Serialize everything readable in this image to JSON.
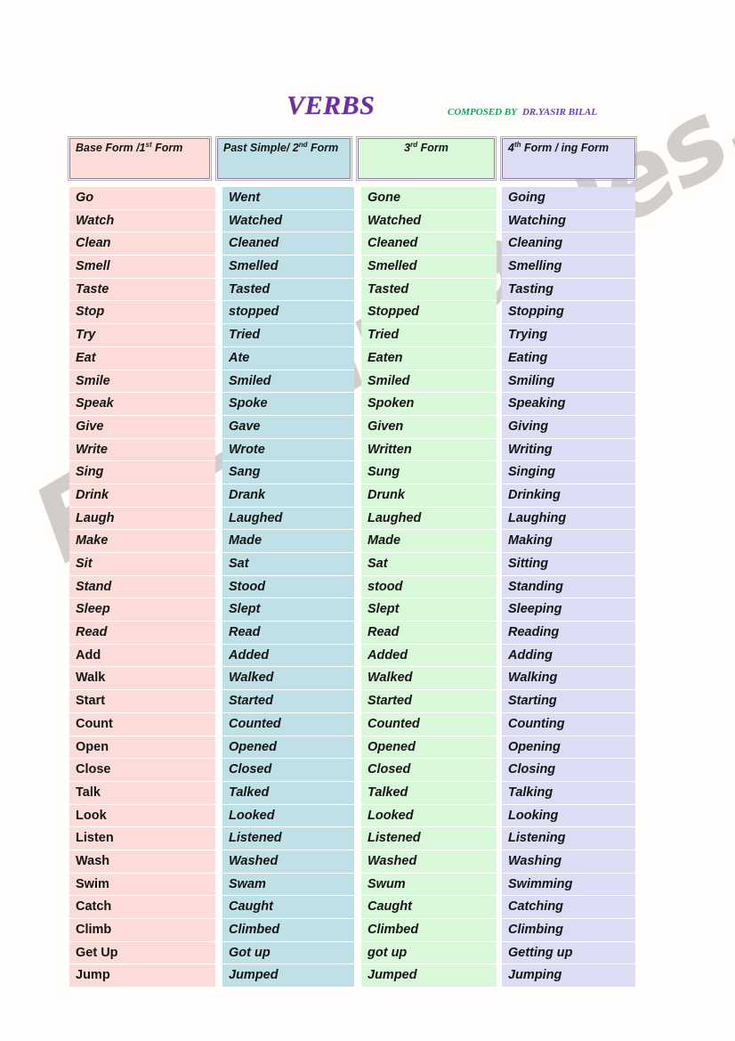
{
  "document": {
    "title": "VERBS",
    "credit_composed": "COMPOSED BY",
    "credit_author": "DR.YASIR BILAL",
    "watermark": "ESLprintables.com"
  },
  "colors": {
    "title": "#6b2f9e",
    "credit_composed": "#16a35a",
    "credit_author": "#6b3fa0",
    "col1_bg": "#fbdcd8",
    "col2_bg": "#bfe0e6",
    "col3_bg": "#d9f7d9",
    "col4_bg": "#dcdcf5",
    "header_border": "#8a7f92"
  },
  "table": {
    "headers": [
      {
        "main": "Base Form /1",
        "sup": "st",
        "tail": " Form",
        "align": "left"
      },
      {
        "main": "Past Simple/ 2",
        "sup": "nd",
        "tail": " Form",
        "align": "left"
      },
      {
        "main": "3",
        "sup": "rd",
        "tail": " Form",
        "align": "center"
      },
      {
        "main": "4",
        "sup": "th",
        "tail": " Form / ing Form",
        "align": "left"
      }
    ],
    "rows": [
      {
        "base": "Go",
        "past": "Went",
        "third": "Gone",
        "ing": "Going",
        "base_upright": false
      },
      {
        "base": "Watch",
        "past": "Watched",
        "third": "Watched",
        "ing": "Watching",
        "base_upright": false
      },
      {
        "base": "Clean",
        "past": "Cleaned",
        "third": "Cleaned",
        "ing": "Cleaning",
        "base_upright": false
      },
      {
        "base": "Smell",
        "past": "Smelled",
        "third": "Smelled",
        "ing": "Smelling",
        "base_upright": false
      },
      {
        "base": "Taste",
        "past": "Tasted",
        "third": "Tasted",
        "ing": "Tasting",
        "base_upright": false
      },
      {
        "base": "Stop",
        "past": "stopped",
        "third": "Stopped",
        "ing": "Stopping",
        "base_upright": false
      },
      {
        "base": "Try",
        "past": "Tried",
        "third": "Tried",
        "ing": "Trying",
        "base_upright": false
      },
      {
        "base": "Eat",
        "past": "Ate",
        "third": "Eaten",
        "ing": "Eating",
        "base_upright": false
      },
      {
        "base": "Smile",
        "past": "Smiled",
        "third": "Smiled",
        "ing": "Smiling",
        "base_upright": false
      },
      {
        "base": "Speak",
        "past": "Spoke",
        "third": "Spoken",
        "ing": "Speaking",
        "base_upright": false
      },
      {
        "base": "Give",
        "past": "Gave",
        "third": "Given",
        "ing": "Giving",
        "base_upright": false
      },
      {
        "base": "Write",
        "past": "Wrote",
        "third": "Written",
        "ing": "Writing",
        "base_upright": false
      },
      {
        "base": "Sing",
        "past": "Sang",
        "third": "Sung",
        "ing": "Singing",
        "base_upright": false
      },
      {
        "base": "Drink",
        "past": "Drank",
        "third": "Drunk",
        "ing": "Drinking",
        "base_upright": false
      },
      {
        "base": "Laugh",
        "past": "Laughed",
        "third": "Laughed",
        "ing": "Laughing",
        "base_upright": false
      },
      {
        "base": "Make",
        "past": "Made",
        "third": "Made",
        "ing": "Making",
        "base_upright": false
      },
      {
        "base": "Sit",
        "past": "Sat",
        "third": "Sat",
        "ing": "Sitting",
        "base_upright": false
      },
      {
        "base": "Stand",
        "past": "Stood",
        "third": "stood",
        "ing": "Standing",
        "base_upright": false
      },
      {
        "base": "Sleep",
        "past": "Slept",
        "third": "Slept",
        "ing": "Sleeping",
        "base_upright": false
      },
      {
        "base": "Read",
        "past": "Read",
        "third": "Read",
        "ing": "Reading",
        "base_upright": false
      },
      {
        "base": "Add",
        "past": "Added",
        "third": "Added",
        "ing": "Adding",
        "base_upright": true
      },
      {
        "base": "Walk",
        "past": "Walked",
        "third": "Walked",
        "ing": "Walking",
        "base_upright": true
      },
      {
        "base": "Start",
        "past": "Started",
        "third": "Started",
        "ing": "Starting",
        "base_upright": true
      },
      {
        "base": "Count",
        "past": "Counted",
        "third": "Counted",
        "ing": "Counting",
        "base_upright": true
      },
      {
        "base": "Open",
        "past": "Opened",
        "third": "Opened",
        "ing": "Opening",
        "base_upright": true
      },
      {
        "base": "Close",
        "past": "Closed",
        "third": "Closed",
        "ing": "Closing",
        "base_upright": true
      },
      {
        "base": "Talk",
        "past": "Talked",
        "third": "Talked",
        "ing": "Talking",
        "base_upright": true
      },
      {
        "base": "Look",
        "past": "Looked",
        "third": "Looked",
        "ing": "Looking",
        "base_upright": true
      },
      {
        "base": "Listen",
        "past": "Listened",
        "third": "Listened",
        "ing": "Listening",
        "base_upright": true
      },
      {
        "base": "Wash",
        "past": "Washed",
        "third": "Washed",
        "ing": "Washing",
        "base_upright": true
      },
      {
        "base": "Swim",
        "past": "Swam",
        "third": "Swum",
        "ing": "Swimming",
        "base_upright": true
      },
      {
        "base": "Catch",
        "past": "Caught",
        "third": "Caught",
        "ing": "Catching",
        "base_upright": true
      },
      {
        "base": "Climb",
        "past": "Climbed",
        "third": "Climbed",
        "ing": "Climbing",
        "base_upright": true
      },
      {
        "base": "Get Up",
        "past": "Got up",
        "third": "got up",
        "ing": "Getting up",
        "base_upright": true
      },
      {
        "base": "Jump",
        "past": "Jumped",
        "third": "Jumped",
        "ing": "Jumping",
        "base_upright": true
      }
    ]
  }
}
